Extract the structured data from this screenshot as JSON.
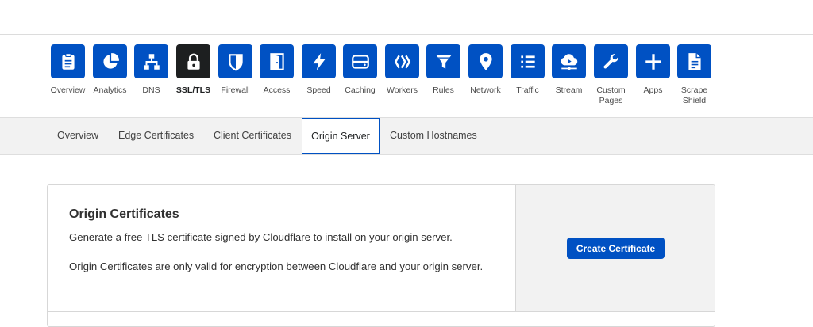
{
  "nav": {
    "items": [
      {
        "label": "Overview",
        "icon": "clipboard-icon"
      },
      {
        "label": "Analytics",
        "icon": "pie-chart-icon"
      },
      {
        "label": "DNS",
        "icon": "network-tree-icon"
      },
      {
        "label": "SSL/TLS",
        "icon": "lock-icon"
      },
      {
        "label": "Firewall",
        "icon": "shield-icon"
      },
      {
        "label": "Access",
        "icon": "door-icon"
      },
      {
        "label": "Speed",
        "icon": "lightning-icon"
      },
      {
        "label": "Caching",
        "icon": "server-icon"
      },
      {
        "label": "Workers",
        "icon": "workers-icon"
      },
      {
        "label": "Rules",
        "icon": "filter-icon"
      },
      {
        "label": "Network",
        "icon": "location-pin-icon"
      },
      {
        "label": "Traffic",
        "icon": "list-icon"
      },
      {
        "label": "Stream",
        "icon": "cloud-stream-icon"
      },
      {
        "label": "Custom\nPages",
        "icon": "wrench-icon"
      },
      {
        "label": "Apps",
        "icon": "plus-icon"
      },
      {
        "label": "Scrape\nShield",
        "icon": "document-icon"
      }
    ],
    "active": "SSL/TLS"
  },
  "subnav": {
    "tabs": [
      {
        "label": "Overview"
      },
      {
        "label": "Edge Certificates"
      },
      {
        "label": "Client Certificates"
      },
      {
        "label": "Origin Server"
      },
      {
        "label": "Custom Hostnames"
      }
    ],
    "active": "Origin Server"
  },
  "origin_card": {
    "title": "Origin Certificates",
    "description": "Generate a free TLS certificate signed by Cloudflare to install on your origin server.",
    "note": "Origin Certificates are only valid for encryption between Cloudflare and your origin server.",
    "button_label": "Create Certificate"
  },
  "colors": {
    "accent": "#0051c3",
    "active_tile": "#1d1f20",
    "subnav_bg": "#f2f2f2"
  }
}
